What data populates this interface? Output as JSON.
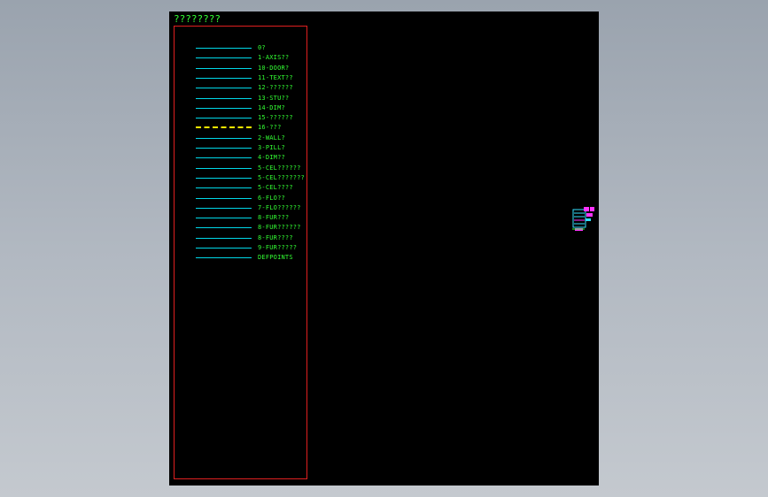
{
  "sheet": {
    "title": "????????"
  },
  "legend": {
    "items": [
      {
        "label": "0?",
        "line_color": "#00d8e8",
        "line_style": "solid"
      },
      {
        "label": "1-AXIS??",
        "line_color": "#00d8e8",
        "line_style": "solid"
      },
      {
        "label": "10-DOOR?",
        "line_color": "#00d8e8",
        "line_style": "solid"
      },
      {
        "label": "11-TEXT??",
        "line_color": "#00d8e8",
        "line_style": "solid"
      },
      {
        "label": "12-??????",
        "line_color": "#00d8e8",
        "line_style": "solid"
      },
      {
        "label": "13-STU??",
        "line_color": "#00d8e8",
        "line_style": "solid"
      },
      {
        "label": "14-DIM?",
        "line_color": "#00d8e8",
        "line_style": "solid"
      },
      {
        "label": "15-??????",
        "line_color": "#00d8e8",
        "line_style": "solid"
      },
      {
        "label": "16-???",
        "line_color": "#ffee00",
        "line_style": "dashed"
      },
      {
        "label": "2-WALL?",
        "line_color": "#00d8e8",
        "line_style": "solid"
      },
      {
        "label": "3-PILL?",
        "line_color": "#00d8e8",
        "line_style": "solid"
      },
      {
        "label": "4-DIM??",
        "line_color": "#00d8e8",
        "line_style": "solid"
      },
      {
        "label": "5-CEL??????",
        "line_color": "#00d8e8",
        "line_style": "solid"
      },
      {
        "label": "5-CEL???????",
        "line_color": "#00d8e8",
        "line_style": "solid"
      },
      {
        "label": "5-CEL????",
        "line_color": "#00d8e8",
        "line_style": "solid"
      },
      {
        "label": "6-FLO??",
        "line_color": "#00d8e8",
        "line_style": "solid"
      },
      {
        "label": "7-FLO??????",
        "line_color": "#00d8e8",
        "line_style": "solid"
      },
      {
        "label": "8-FUR???",
        "line_color": "#00d8e8",
        "line_style": "solid"
      },
      {
        "label": "8-FUR??????",
        "line_color": "#00d8e8",
        "line_style": "solid"
      },
      {
        "label": "8-FUR????",
        "line_color": "#00d8e8",
        "line_style": "solid"
      },
      {
        "label": "9-FUR?????",
        "line_color": "#00d8e8",
        "line_style": "solid"
      },
      {
        "label": "DEFPOINTS",
        "line_color": "#00d8e8",
        "line_style": "solid"
      }
    ]
  },
  "colors": {
    "viewport_background": "#9aa3ae",
    "canvas_background": "#000000",
    "frame_border": "#e02020",
    "label_text": "#33ff33",
    "solid_line": "#00d8e8",
    "dashed_line": "#ffee00",
    "cluster_magenta": "#ff33ff",
    "cluster_cyan": "#33e0ff"
  }
}
